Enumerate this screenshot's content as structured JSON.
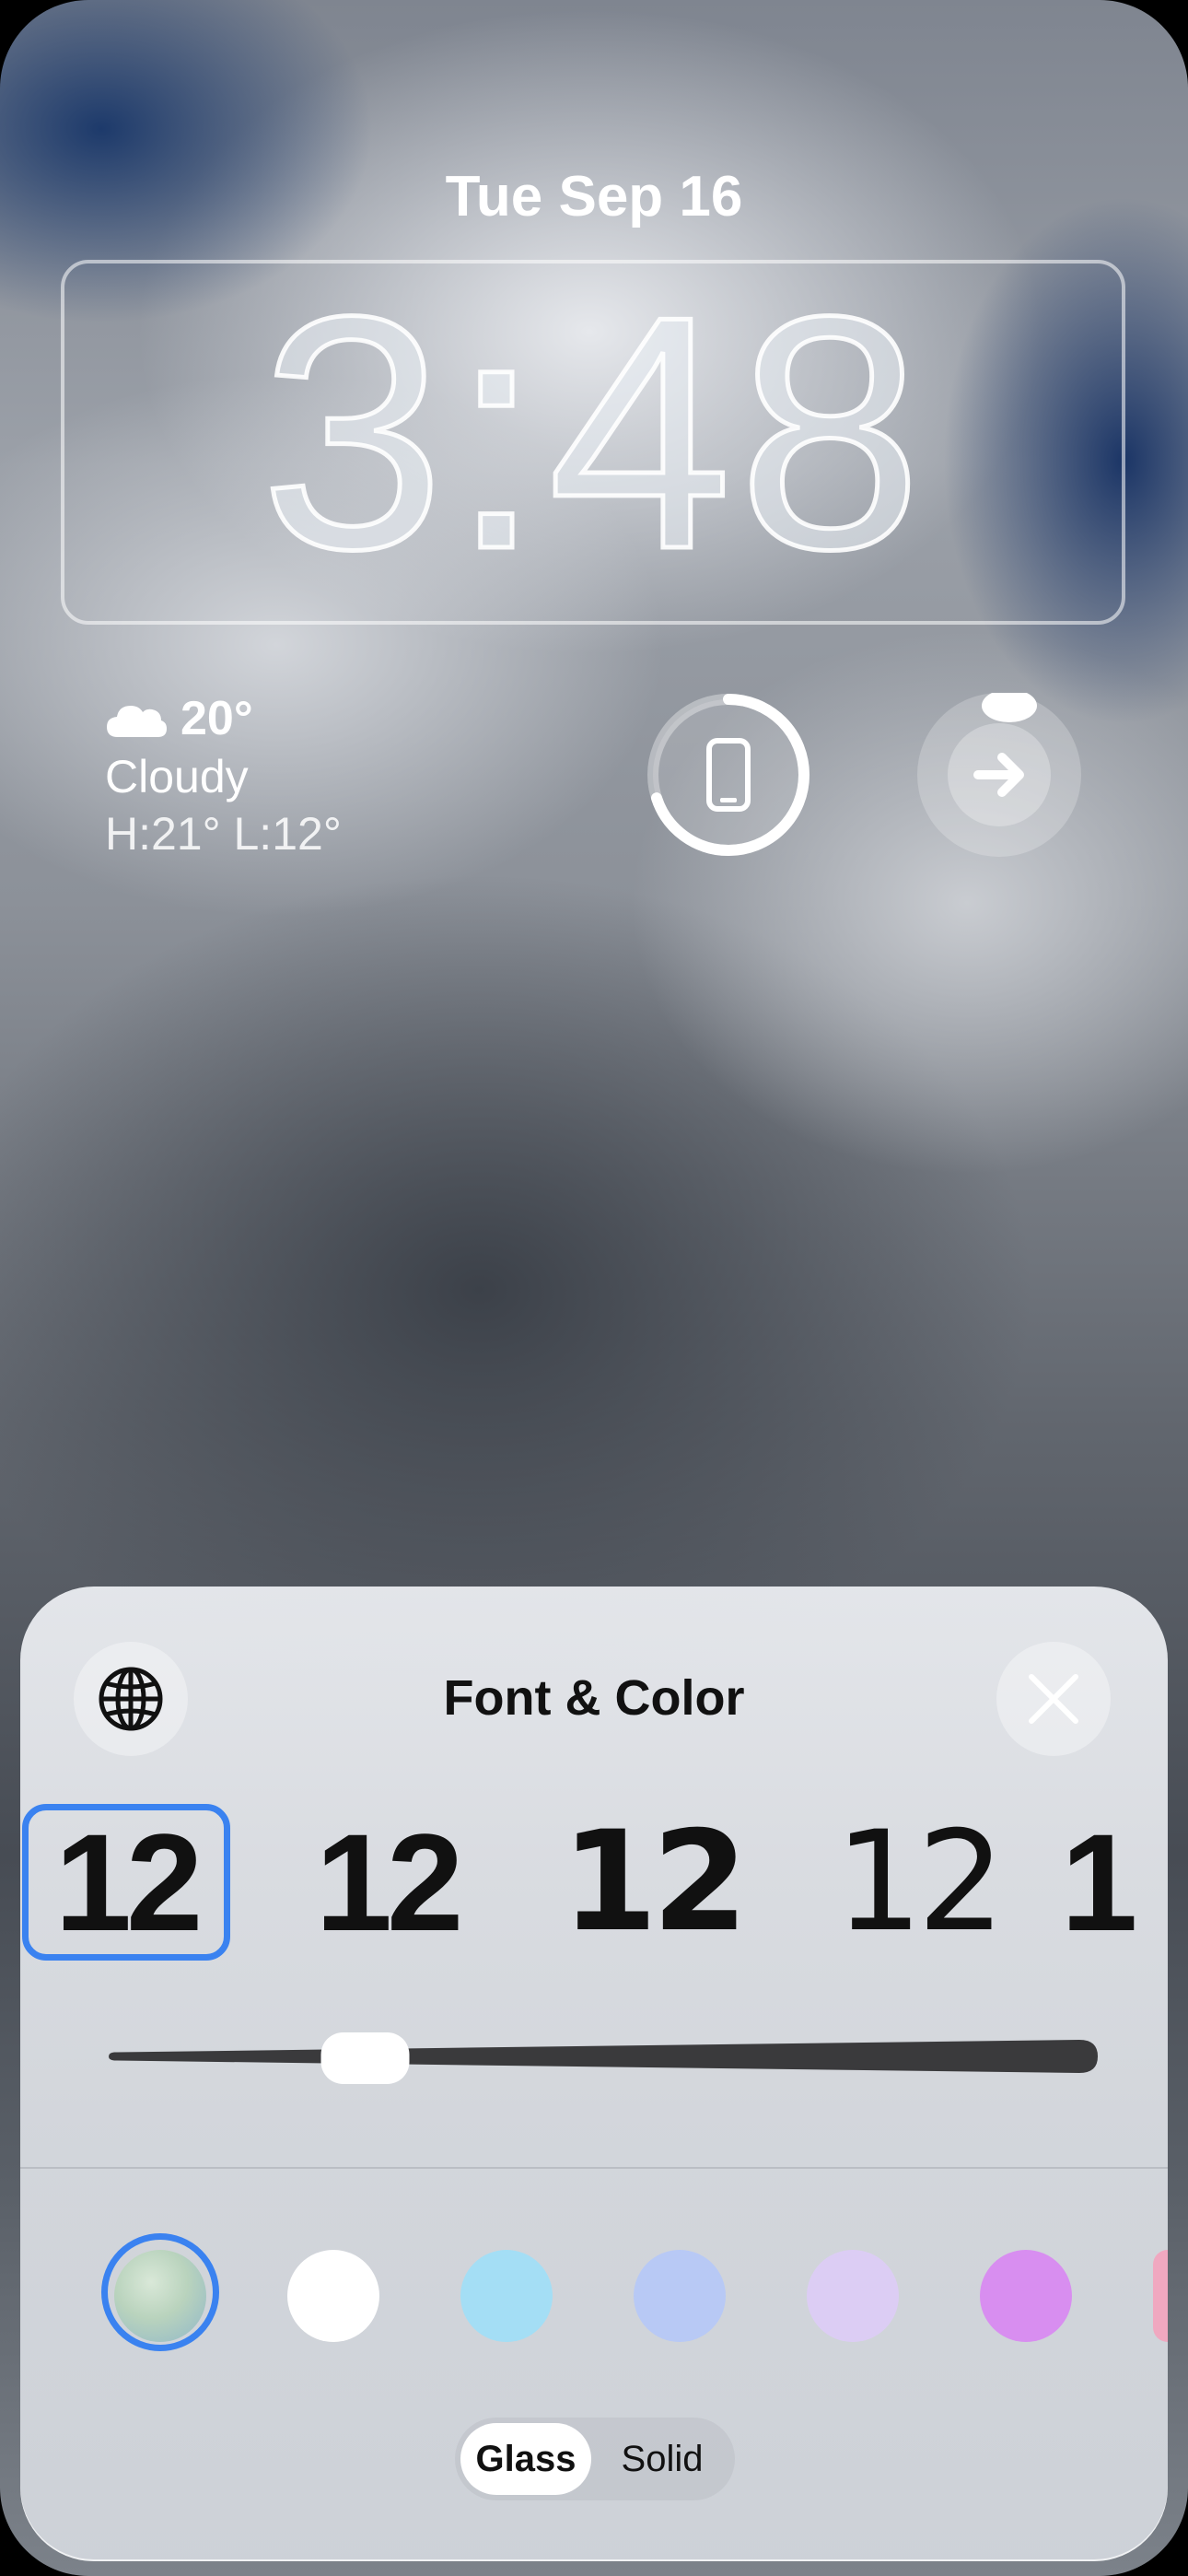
{
  "lockscreen": {
    "date": "Tue Sep 16",
    "time": "3:48",
    "weather": {
      "temperature": "20°",
      "condition": "Cloudy",
      "high_low": "H:21° L:12°",
      "icon": "cloud-icon"
    },
    "widgets": [
      {
        "name": "phone-battery-widget",
        "icon": "iphone-icon",
        "progress": 0.7
      },
      {
        "name": "shortcut-widget",
        "icon": "arrow-right-icon"
      }
    ]
  },
  "panel": {
    "title": "Font & Color",
    "globe_icon": "globe-icon",
    "close_icon": "close-icon",
    "font_options": [
      "12",
      "12",
      "12",
      "12",
      "1"
    ],
    "selected_font_index": 0,
    "weight_slider_value": 0.25,
    "colors": [
      {
        "name": "glass-gradient",
        "hex": "#b9d3bd"
      },
      {
        "name": "white",
        "hex": "#ffffff"
      },
      {
        "name": "sky-blue",
        "hex": "#a4def5"
      },
      {
        "name": "periwinkle",
        "hex": "#b8c9f5"
      },
      {
        "name": "lavender",
        "hex": "#dccdf4"
      },
      {
        "name": "orchid",
        "hex": "#d88ef0"
      },
      {
        "name": "pink",
        "hex": "#f0a8c0"
      }
    ],
    "selected_color_index": 0,
    "style_options": [
      "Glass",
      "Solid"
    ],
    "selected_style": "Glass",
    "accent": "#3a82f0"
  }
}
